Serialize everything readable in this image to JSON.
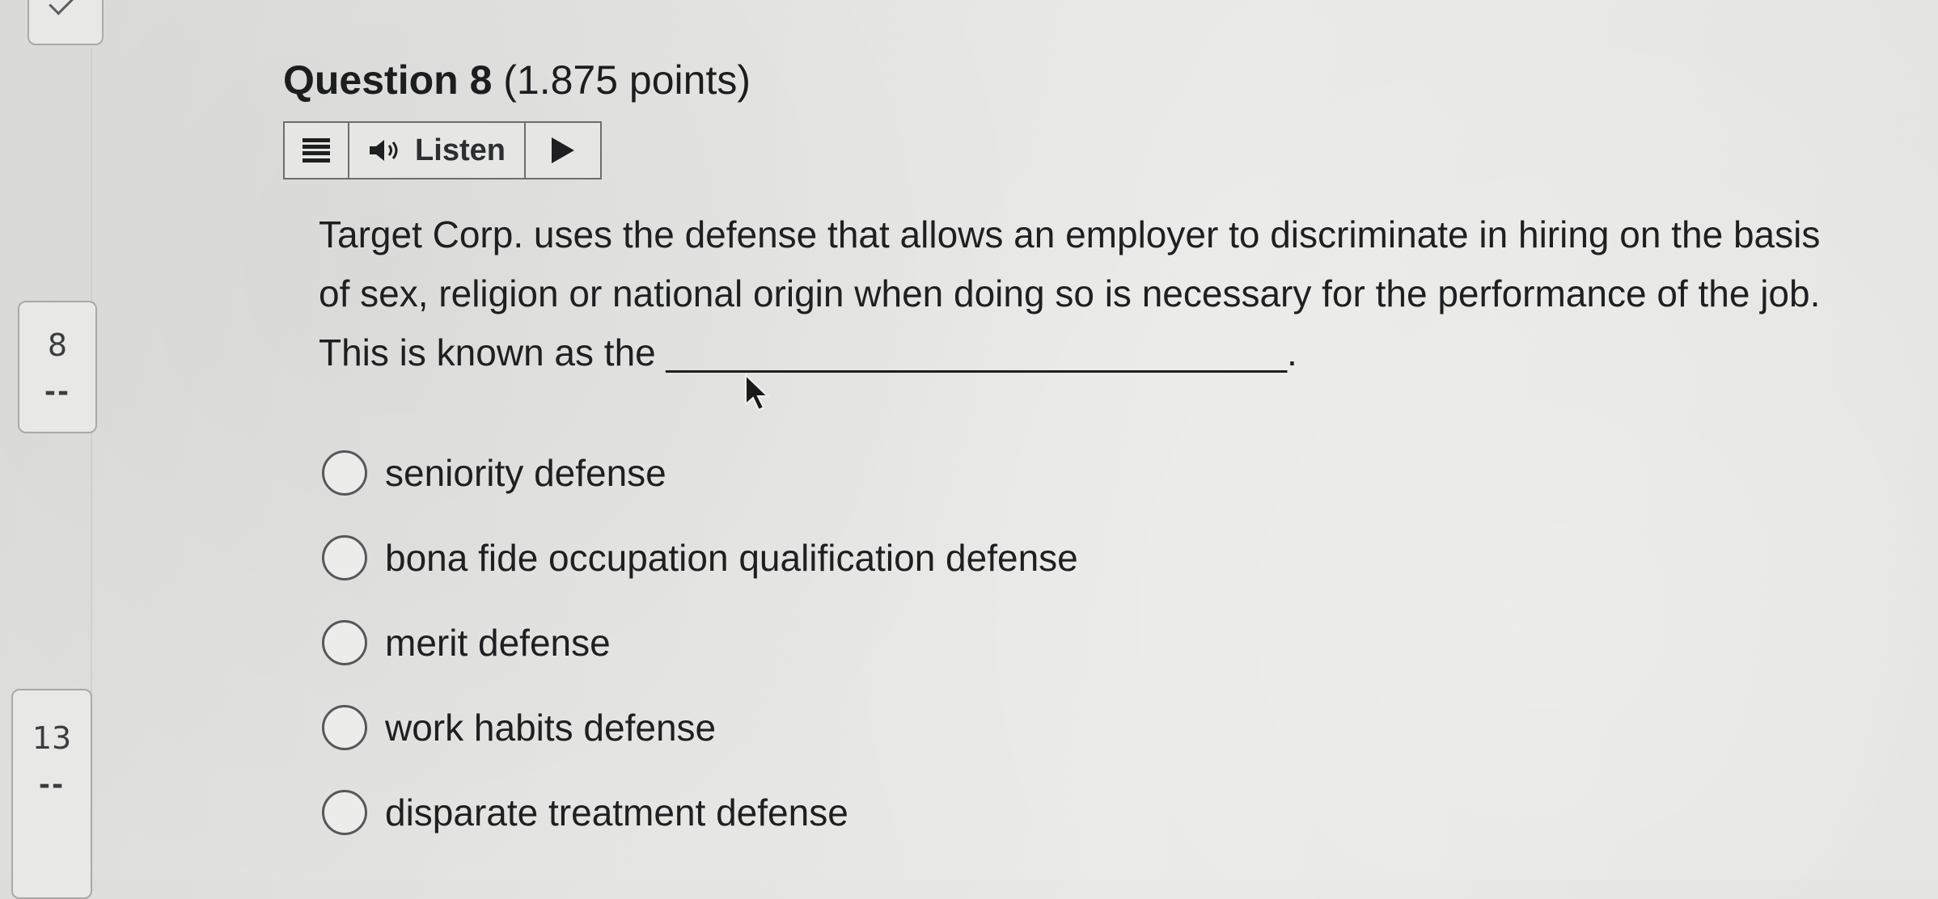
{
  "question": {
    "title_bold": "Question 8",
    "title_points": " (1.875 points)",
    "text": "Target Corp. uses the defense that allows an employer to discriminate in hiring on the basis of sex, religion or national origin when doing so is necessary for the performance of the job.  This is known as the ______________________________."
  },
  "toolbar": {
    "menu_icon": "menu-icon",
    "speaker_icon": "speaker-icon",
    "listen_label": "Listen",
    "play_icon": "play-icon"
  },
  "options": [
    {
      "label": "seniority defense",
      "selected": false
    },
    {
      "label": "bona fide occupation qualification defense",
      "selected": false
    },
    {
      "label": "merit defense",
      "selected": false
    },
    {
      "label": "work habits defense",
      "selected": false
    },
    {
      "label": "disparate treatment defense",
      "selected": false
    }
  ],
  "question_nav": [
    {
      "number": "",
      "status_icon": "check-icon"
    },
    {
      "number": "8",
      "status": "--"
    },
    {
      "number": "13",
      "status": "--"
    }
  ]
}
